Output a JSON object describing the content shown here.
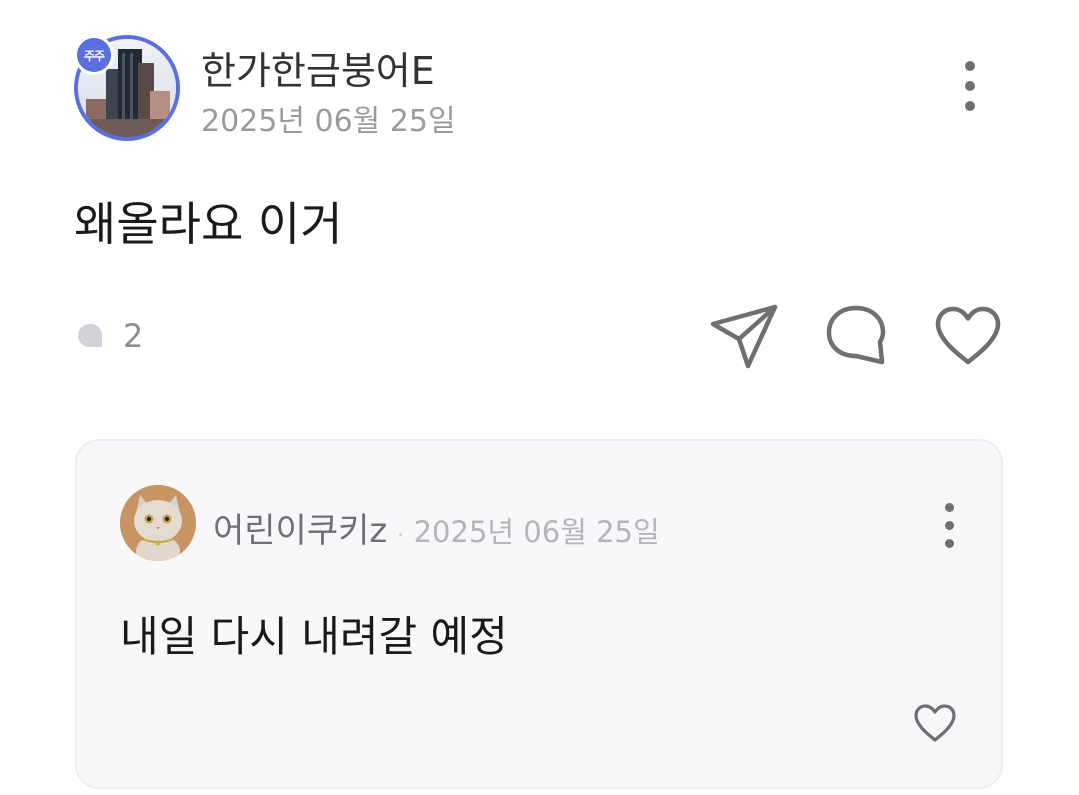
{
  "post": {
    "author": "한가한금붕어E",
    "stock_badge": "주주",
    "date": "2025년 06월 25일",
    "content": "왜올라요 이거",
    "comment_count": "2"
  },
  "comments": [
    {
      "author": "어린이쿠키z",
      "separator": "·",
      "date": "2025년 06월 25일",
      "text": "내일 다시 내려갈 예정"
    }
  ],
  "colors": {
    "accent": "#5a6fe0",
    "icon": "#6e6e73",
    "muted_text": "#9a9a9f",
    "card_bg": "#f8f8fa"
  },
  "icons": {
    "post_more": "more-vertical-icon",
    "comment_count": "speech-bubble-icon",
    "share": "paper-plane-icon",
    "comment": "chat-bubble-icon",
    "like": "heart-icon",
    "comment_more": "more-vertical-icon",
    "comment_like": "heart-icon"
  }
}
